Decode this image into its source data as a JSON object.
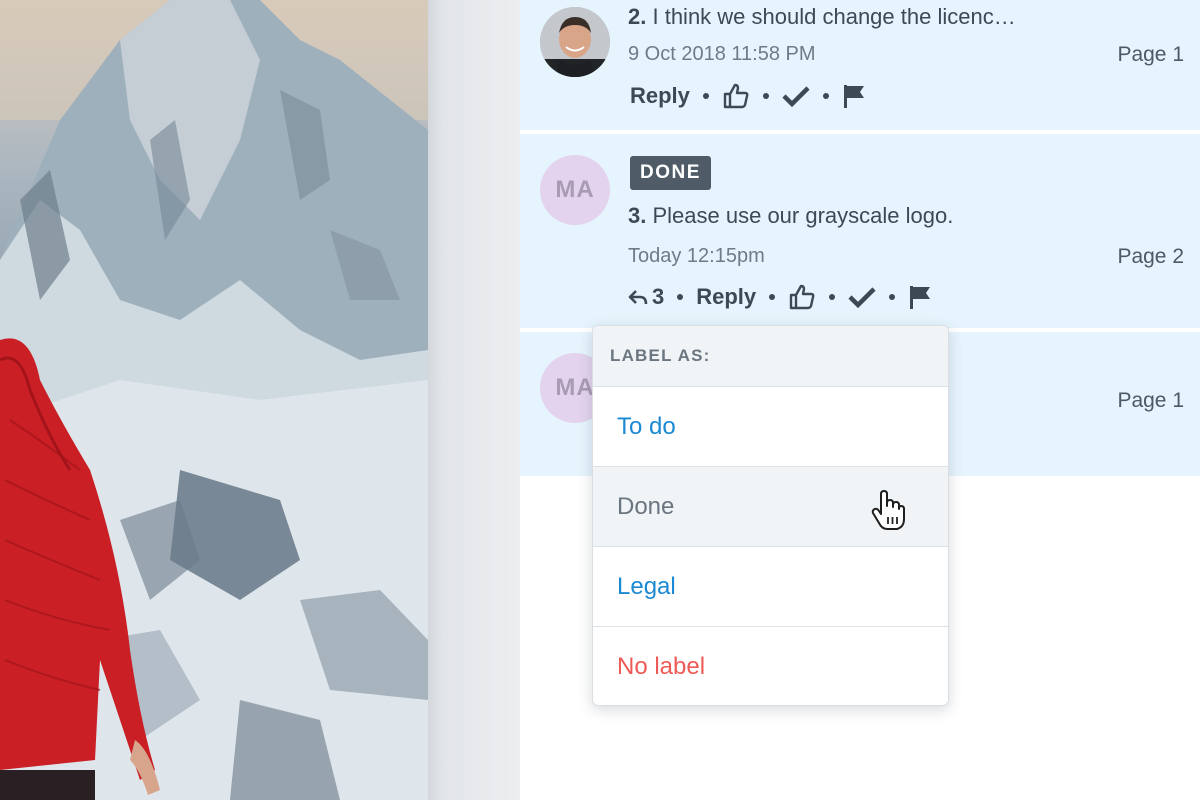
{
  "comments": [
    {
      "number": "2.",
      "text": "I think we should change the licenc…",
      "timestamp": "9 Oct 2018 11:58 PM",
      "page": "Page 1",
      "reply_label": "Reply",
      "avatar_icon": "user-photo"
    },
    {
      "badge": "DONE",
      "initials": "MA",
      "number": "3.",
      "text": "Please use our grayscale logo.",
      "timestamp": "Today 12:15pm",
      "page": "Page 2",
      "reply_count": "3",
      "reply_label": "Reply"
    },
    {
      "initials": "MA",
      "page": "Page 1"
    }
  ],
  "label_menu": {
    "header": "LABEL AS:",
    "options": [
      {
        "label": "To do",
        "color": "#1b8ad3"
      },
      {
        "label": "Done",
        "color": "#6b7580"
      },
      {
        "label": "Legal",
        "color": "#1b8ad3"
      },
      {
        "label": "No label",
        "color": "#ee5a55"
      }
    ]
  },
  "colors": {
    "comment_background": "#e6f4fd",
    "badge_background": "#4f5c67",
    "link_blue": "#1b8ad3",
    "danger_red": "#ee5a55"
  },
  "icons": [
    "reply-arrow-icon",
    "thumbs-up-icon",
    "checkmark-icon",
    "flag-icon",
    "hand-cursor-icon"
  ]
}
